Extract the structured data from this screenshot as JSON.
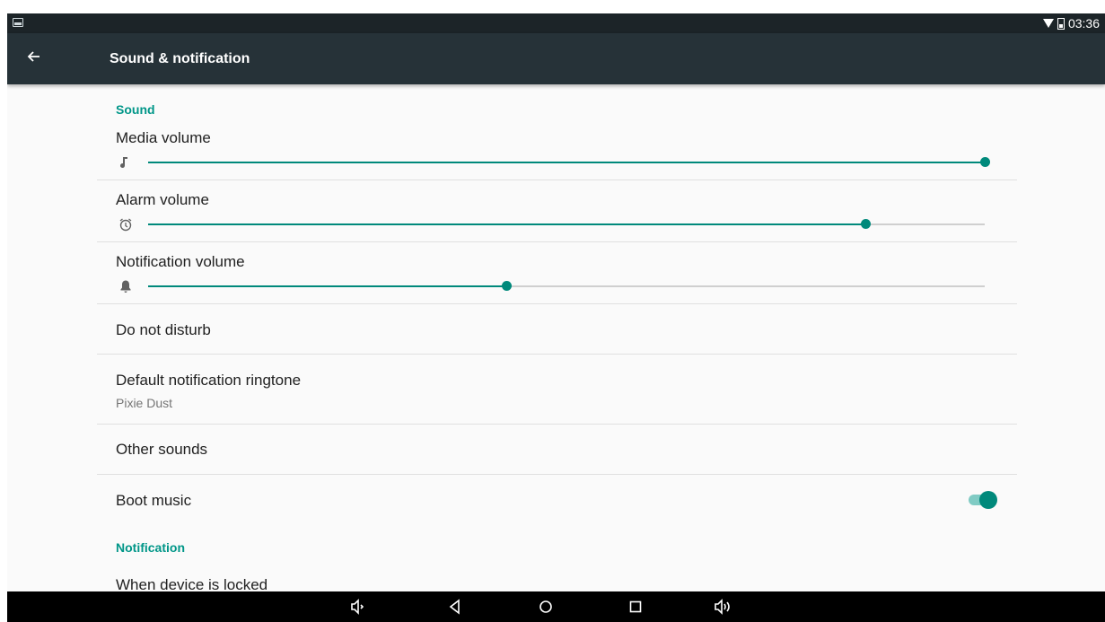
{
  "status_bar": {
    "time": "03:36"
  },
  "app_bar": {
    "title": "Sound & notification"
  },
  "sections": {
    "sound_header": "Sound",
    "notification_header": "Notification"
  },
  "volumes": [
    {
      "label": "Media volume",
      "level": 1.0,
      "icon": "music-note-icon"
    },
    {
      "label": "Alarm volume",
      "level": 0.857,
      "icon": "alarm-icon"
    },
    {
      "label": "Notification volume",
      "level": 0.428,
      "icon": "bell-icon"
    }
  ],
  "items": {
    "do_not_disturb": "Do not disturb",
    "ringtone_title": "Default notification ringtone",
    "ringtone_value": "Pixie Dust",
    "other_sounds": "Other sounds",
    "boot_music": "Boot music",
    "boot_music_on": true,
    "when_locked": "When device is locked"
  },
  "colors": {
    "accent": "#009688",
    "appbar": "#263238",
    "statusbar": "#1c2428"
  }
}
